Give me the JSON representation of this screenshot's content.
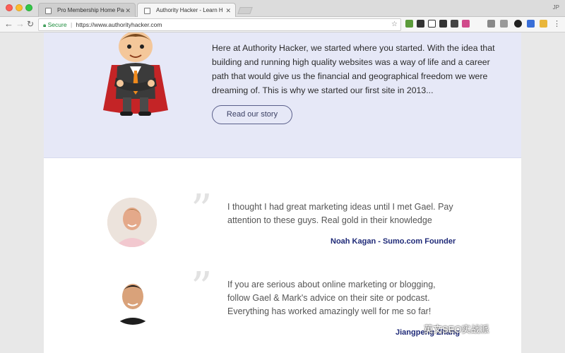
{
  "browser": {
    "tabs": [
      {
        "title": "Pro Membership Home Page -",
        "active": false
      },
      {
        "title": "Authority Hacker - Learn How",
        "active": true
      }
    ],
    "profile": "JP",
    "url_secure_label": "Secure",
    "url": "https://www.authorityhacker.com"
  },
  "hero": {
    "paragraph": "Here at Authority Hacker, we started where you started. With the idea that building and running high quality websites was a way of life and a career path that would give us the financial and geographical freedom we were dreaming of. This is why we started our first site in 2013...",
    "button_label": "Read our story"
  },
  "testimonials": [
    {
      "quote": "I thought I had great marketing ideas until I met Gael. Pay attention to these guys. Real gold in their knowledge",
      "author": "Noah Kagan - Sumo.com Founder"
    },
    {
      "quote": "If you are serious about online marketing or blogging, follow Gael & Mark's advice on their site or podcast. Everything has worked amazingly well for me so far!",
      "author": "Jiangpeng Zhang"
    }
  ],
  "watermark": "英文SEO实战派",
  "colors": {
    "hero_bg": "#e6e8f7",
    "author_link": "#1f2a78",
    "button_border": "#5a5f8a"
  }
}
